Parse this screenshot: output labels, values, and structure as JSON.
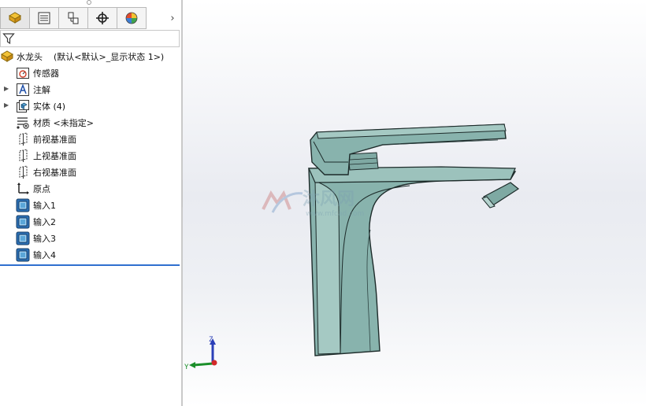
{
  "panel": {
    "tabs": [
      {
        "name": "feature-manager"
      },
      {
        "name": "property-manager"
      },
      {
        "name": "configuration-manager"
      },
      {
        "name": "dimxpert-manager"
      },
      {
        "name": "display-manager"
      }
    ],
    "more_glyph": "›"
  },
  "tree": {
    "root": {
      "label": "水龙头",
      "config": "(默认<默认>_显示状态 1>)"
    },
    "items": [
      {
        "label": "传感器",
        "icon": "sensor-icon"
      },
      {
        "label": "注解",
        "icon": "annotations-icon",
        "expandable": true
      },
      {
        "label": "实体 (4)",
        "icon": "solid-bodies-icon",
        "expandable": true
      },
      {
        "label": "材质 <未指定>",
        "icon": "material-icon"
      },
      {
        "label": "前视基准面",
        "icon": "plane-icon"
      },
      {
        "label": "上视基准面",
        "icon": "plane-icon"
      },
      {
        "label": "右视基准面",
        "icon": "plane-icon"
      },
      {
        "label": "原点",
        "icon": "origin-icon"
      },
      {
        "label": "输入1",
        "icon": "imported-body-icon"
      },
      {
        "label": "输入2",
        "icon": "imported-body-icon"
      },
      {
        "label": "输入3",
        "icon": "imported-body-icon"
      },
      {
        "label": "输入4",
        "icon": "imported-body-icon"
      }
    ]
  },
  "viewport": {
    "model_color": "#88b3ad",
    "edge_color": "#1d2b2a",
    "watermark_text": "沐风网",
    "watermark_url": "www.mfcad.com",
    "triad": {
      "z_label": "Z",
      "y_label": "Y"
    }
  }
}
